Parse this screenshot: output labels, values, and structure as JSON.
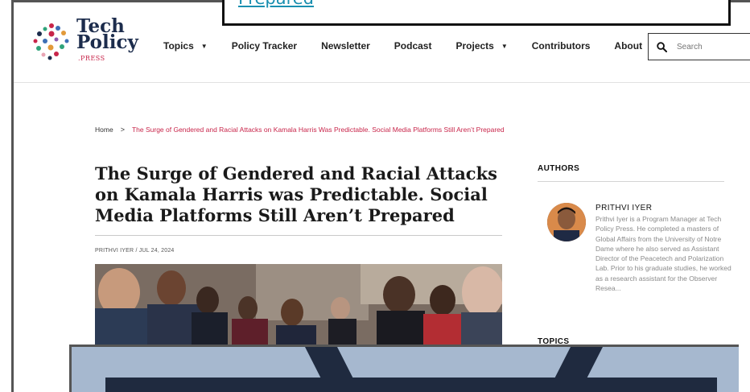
{
  "popup": {
    "link_text": "Prepared"
  },
  "logo": {
    "line1": "Tech",
    "line2": "Policy",
    "line3": ".PRESS"
  },
  "nav": {
    "items": [
      {
        "label": "Topics",
        "dropdown": true
      },
      {
        "label": "Policy Tracker",
        "dropdown": false
      },
      {
        "label": "Newsletter",
        "dropdown": false
      },
      {
        "label": "Podcast",
        "dropdown": false
      },
      {
        "label": "Projects",
        "dropdown": true
      },
      {
        "label": "Contributors",
        "dropdown": false
      },
      {
        "label": "About",
        "dropdown": false
      }
    ]
  },
  "search": {
    "placeholder": "Search",
    "icon": "search-icon"
  },
  "breadcrumb": {
    "home": "Home",
    "separator": ">",
    "current": "The Surge of Gendered and Racial Attacks on Kamala Harris Was Predictable. Social Media Platforms Still Aren’t Prepared"
  },
  "article": {
    "title": "The Surge of Gendered and Racial Attacks on Kamala Harris was Predictable. Social Media Platforms Still Aren’t Prepared",
    "byline": "PRITHVI IYER / JUL 24, 2024"
  },
  "sidebar": {
    "authors_heading": "AUTHORS",
    "author_name": "PRITHVI IYER",
    "author_bio": "Prithvi Iyer is a Program Manager at Tech Policy Press. He completed a masters of Global Affairs from the University of Notre Dame where he also served as Assistant Director of the Peacetech and Polarization Lab. Prior to his graduate studies, he worked as a research assistant for the Observer Resea...",
    "topics_heading": "TOPICS"
  },
  "colors": {
    "accent": "#c8254a",
    "link": "#1a8fb0",
    "logo_navy": "#1c2c4c"
  }
}
